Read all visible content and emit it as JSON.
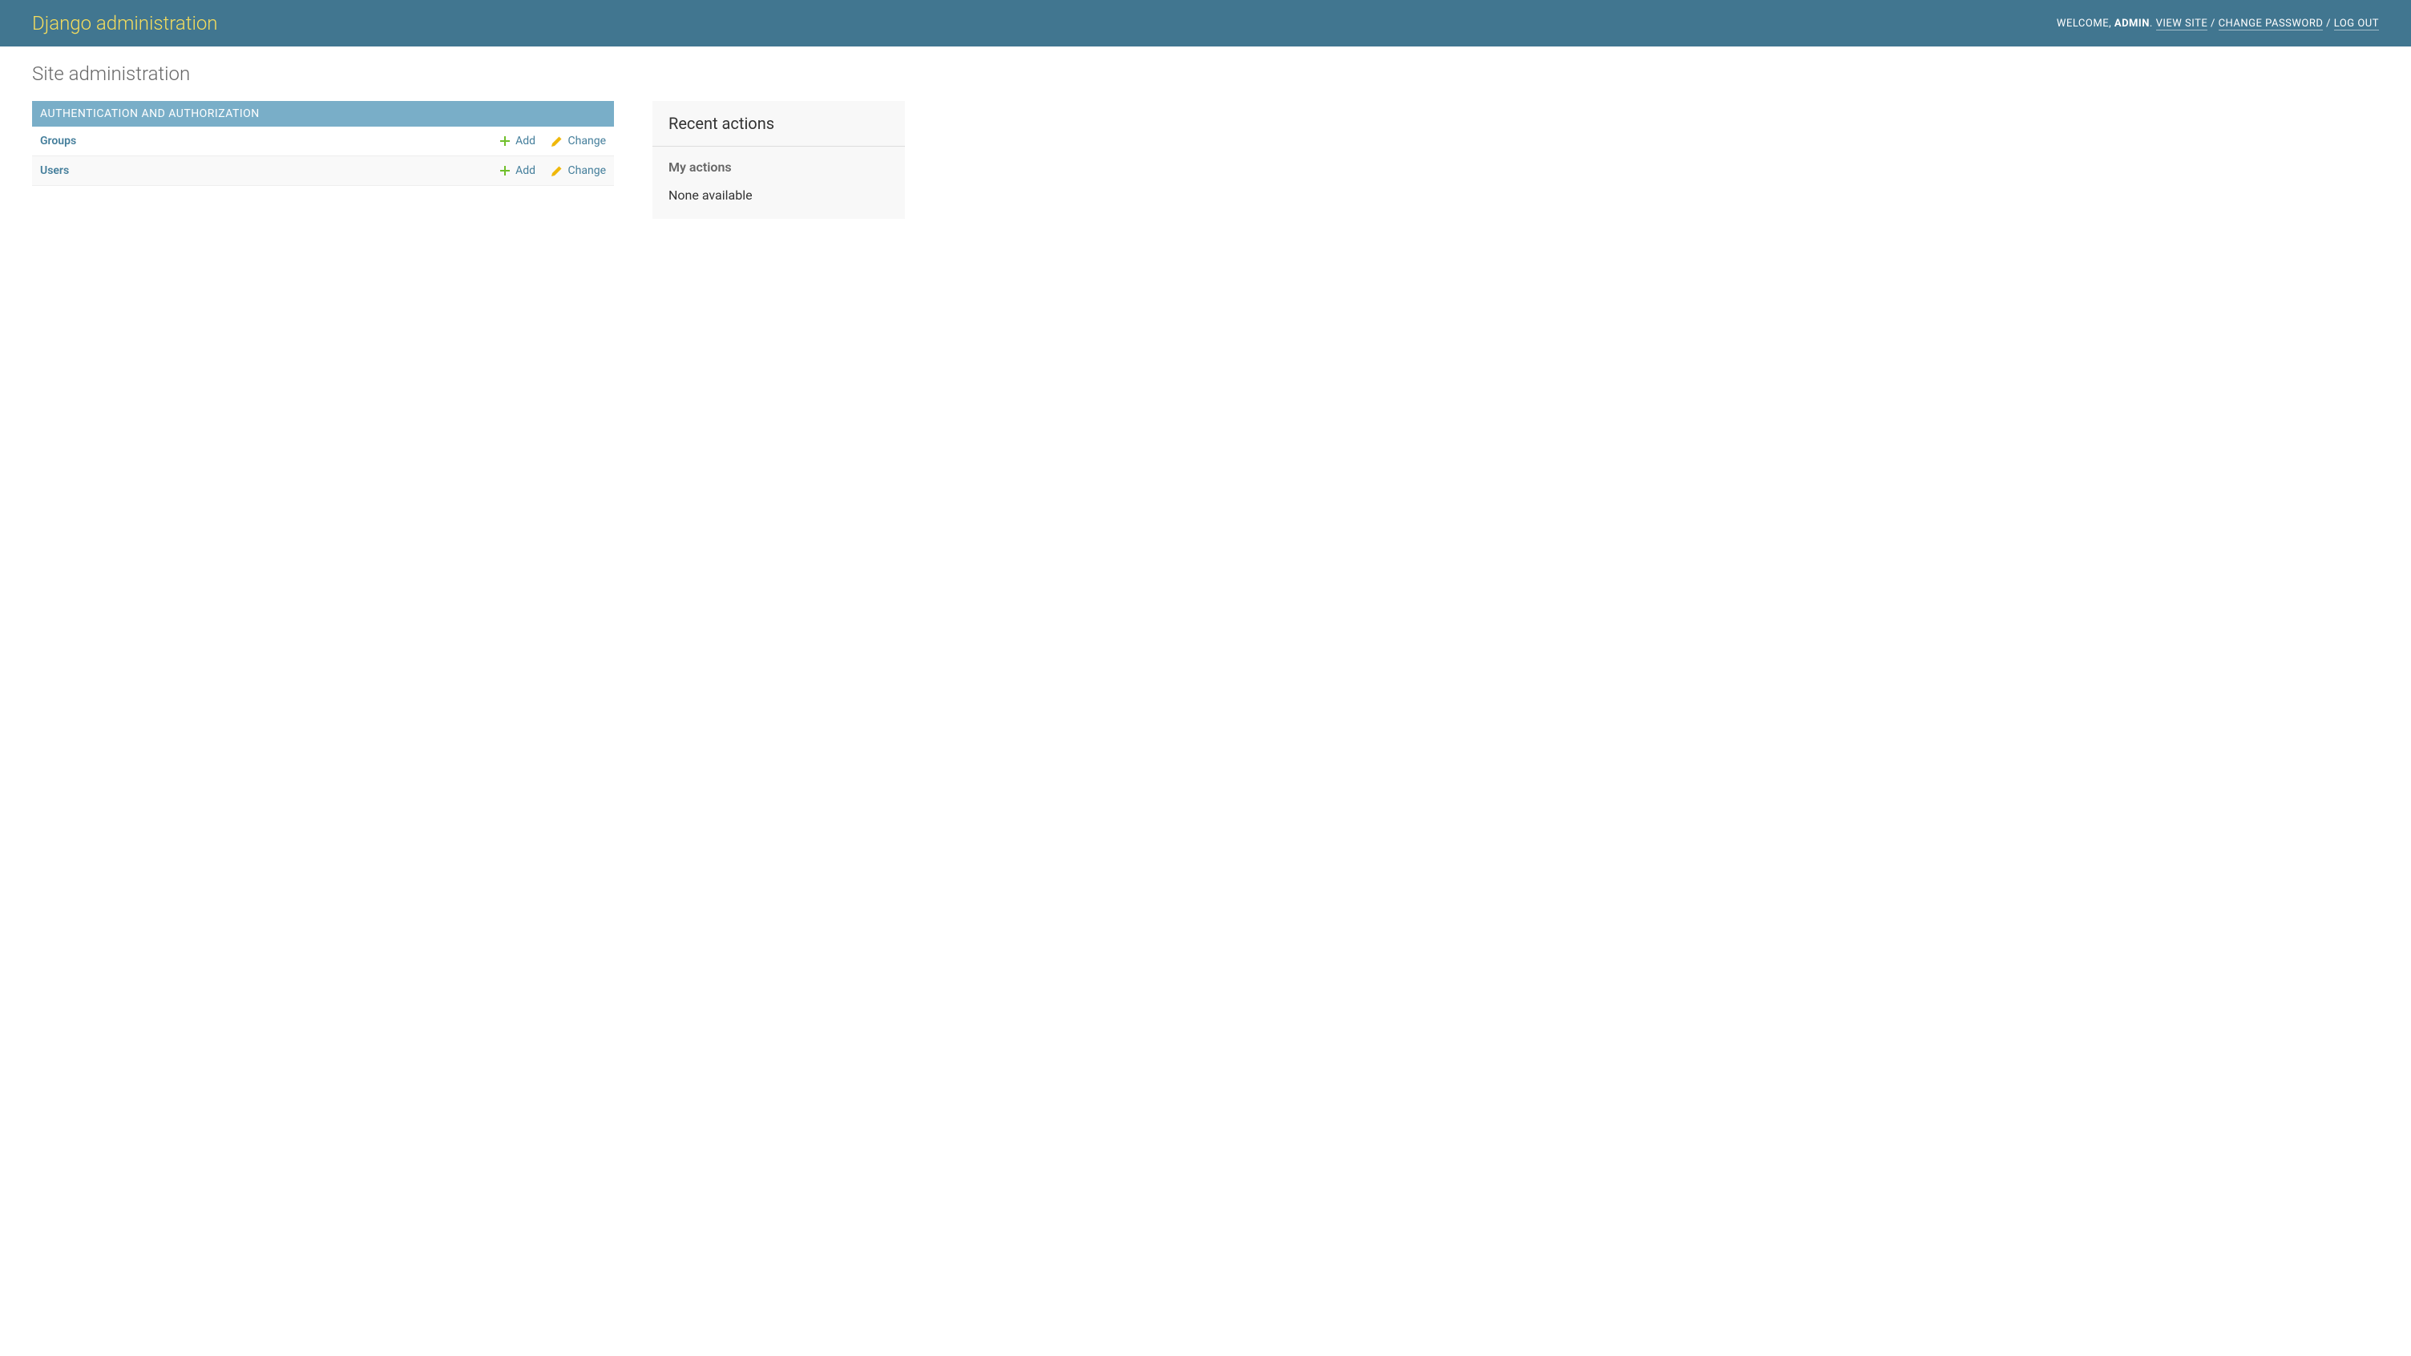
{
  "header": {
    "branding": "Django administration",
    "welcome": "WELCOME, ",
    "username": "ADMIN",
    "view_site": "VIEW SITE",
    "change_password": "CHANGE PASSWORD",
    "log_out": "LOG OUT"
  },
  "content": {
    "title": "Site administration"
  },
  "app": {
    "caption": "AUTHENTICATION AND AUTHORIZATION",
    "models": [
      {
        "name": "Groups",
        "add": "Add",
        "change": "Change"
      },
      {
        "name": "Users",
        "add": "Add",
        "change": "Change"
      }
    ]
  },
  "sidebar": {
    "recent_title": "Recent actions",
    "my_actions": "My actions",
    "none": "None available"
  }
}
